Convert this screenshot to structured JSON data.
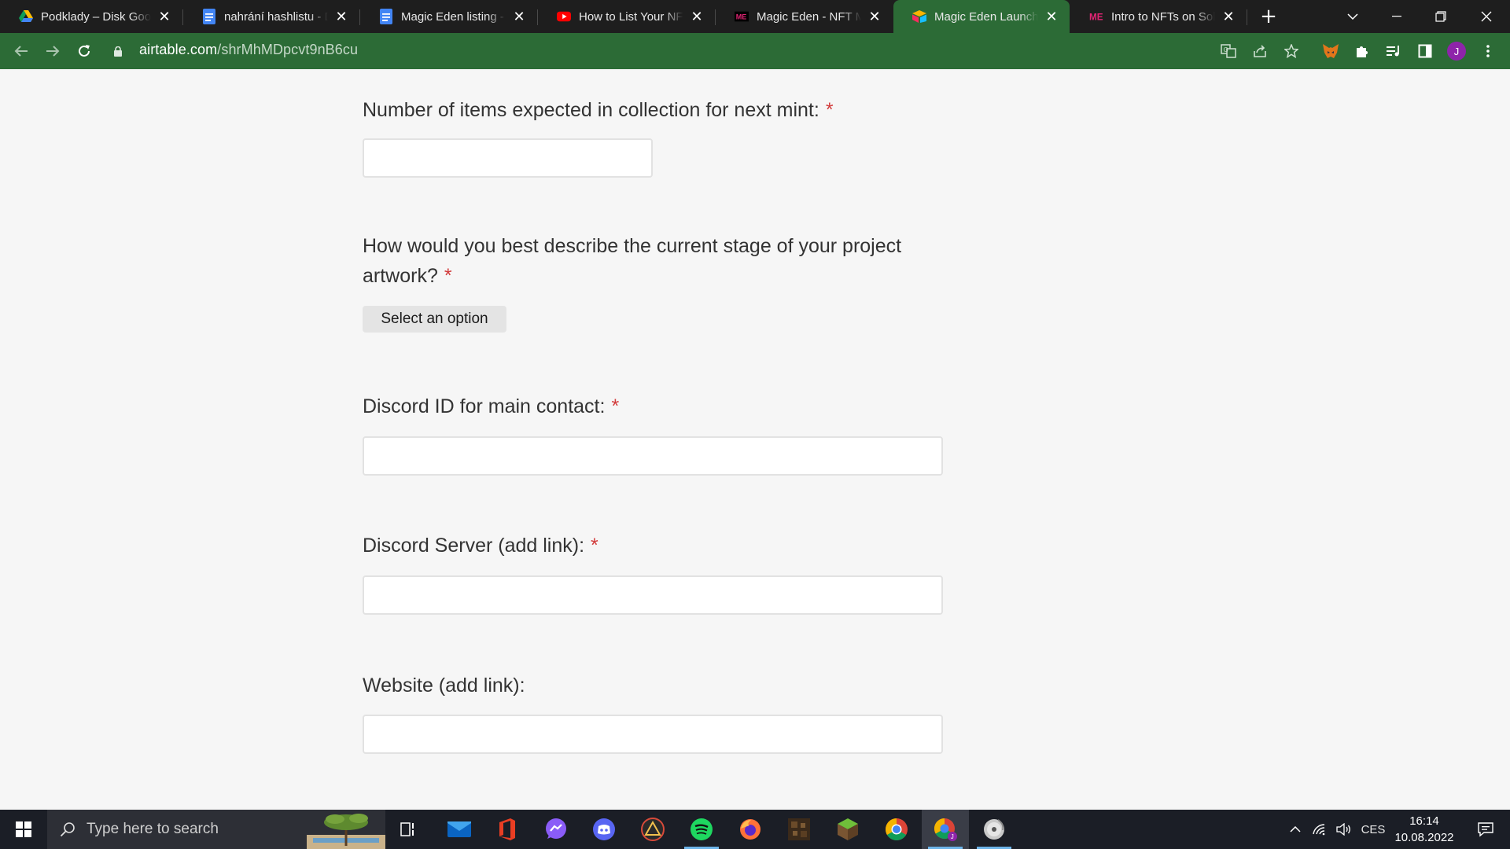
{
  "browser": {
    "tabs": [
      {
        "title": "Podklady – Disk Google",
        "icon": "google-drive-icon"
      },
      {
        "title": "nahrání hashlistu - Dokumenty Google",
        "icon": "google-docs-icon"
      },
      {
        "title": "Magic Eden listing - Dokumenty Google",
        "icon": "google-docs-icon"
      },
      {
        "title": "How to List Your NFT - YouTube",
        "icon": "youtube-icon"
      },
      {
        "title": "Magic Eden - NFT Marketplace",
        "icon": "magic-eden-icon"
      },
      {
        "title": "Magic Eden Launchpad",
        "icon": "airtable-icon"
      },
      {
        "title": "Intro to NFTs on Solana",
        "icon": "magic-eden-icon"
      }
    ],
    "address": {
      "host": "airtable.com",
      "path": "/shrMhMDpcvt9nB6cu"
    },
    "profile_initial": "J"
  },
  "form": {
    "required_mark": "*",
    "q_items": "Number of items expected in collection for next mint:",
    "q_artwork": "How would you best describe the current stage of your project artwork?",
    "select_label": "Select an option",
    "q_discord_id": "Discord ID for main contact:",
    "q_discord_server": "Discord Server (add link):",
    "q_website": "Website (add link):"
  },
  "taskbar": {
    "search_placeholder": "Type here to search",
    "language": "CES",
    "time": "16:14",
    "date": "10.08.2022"
  },
  "colors": {
    "toolbar_green": "#2c6b36",
    "required_red": "#d23b3b",
    "profile_purple": "#8e24aa"
  }
}
